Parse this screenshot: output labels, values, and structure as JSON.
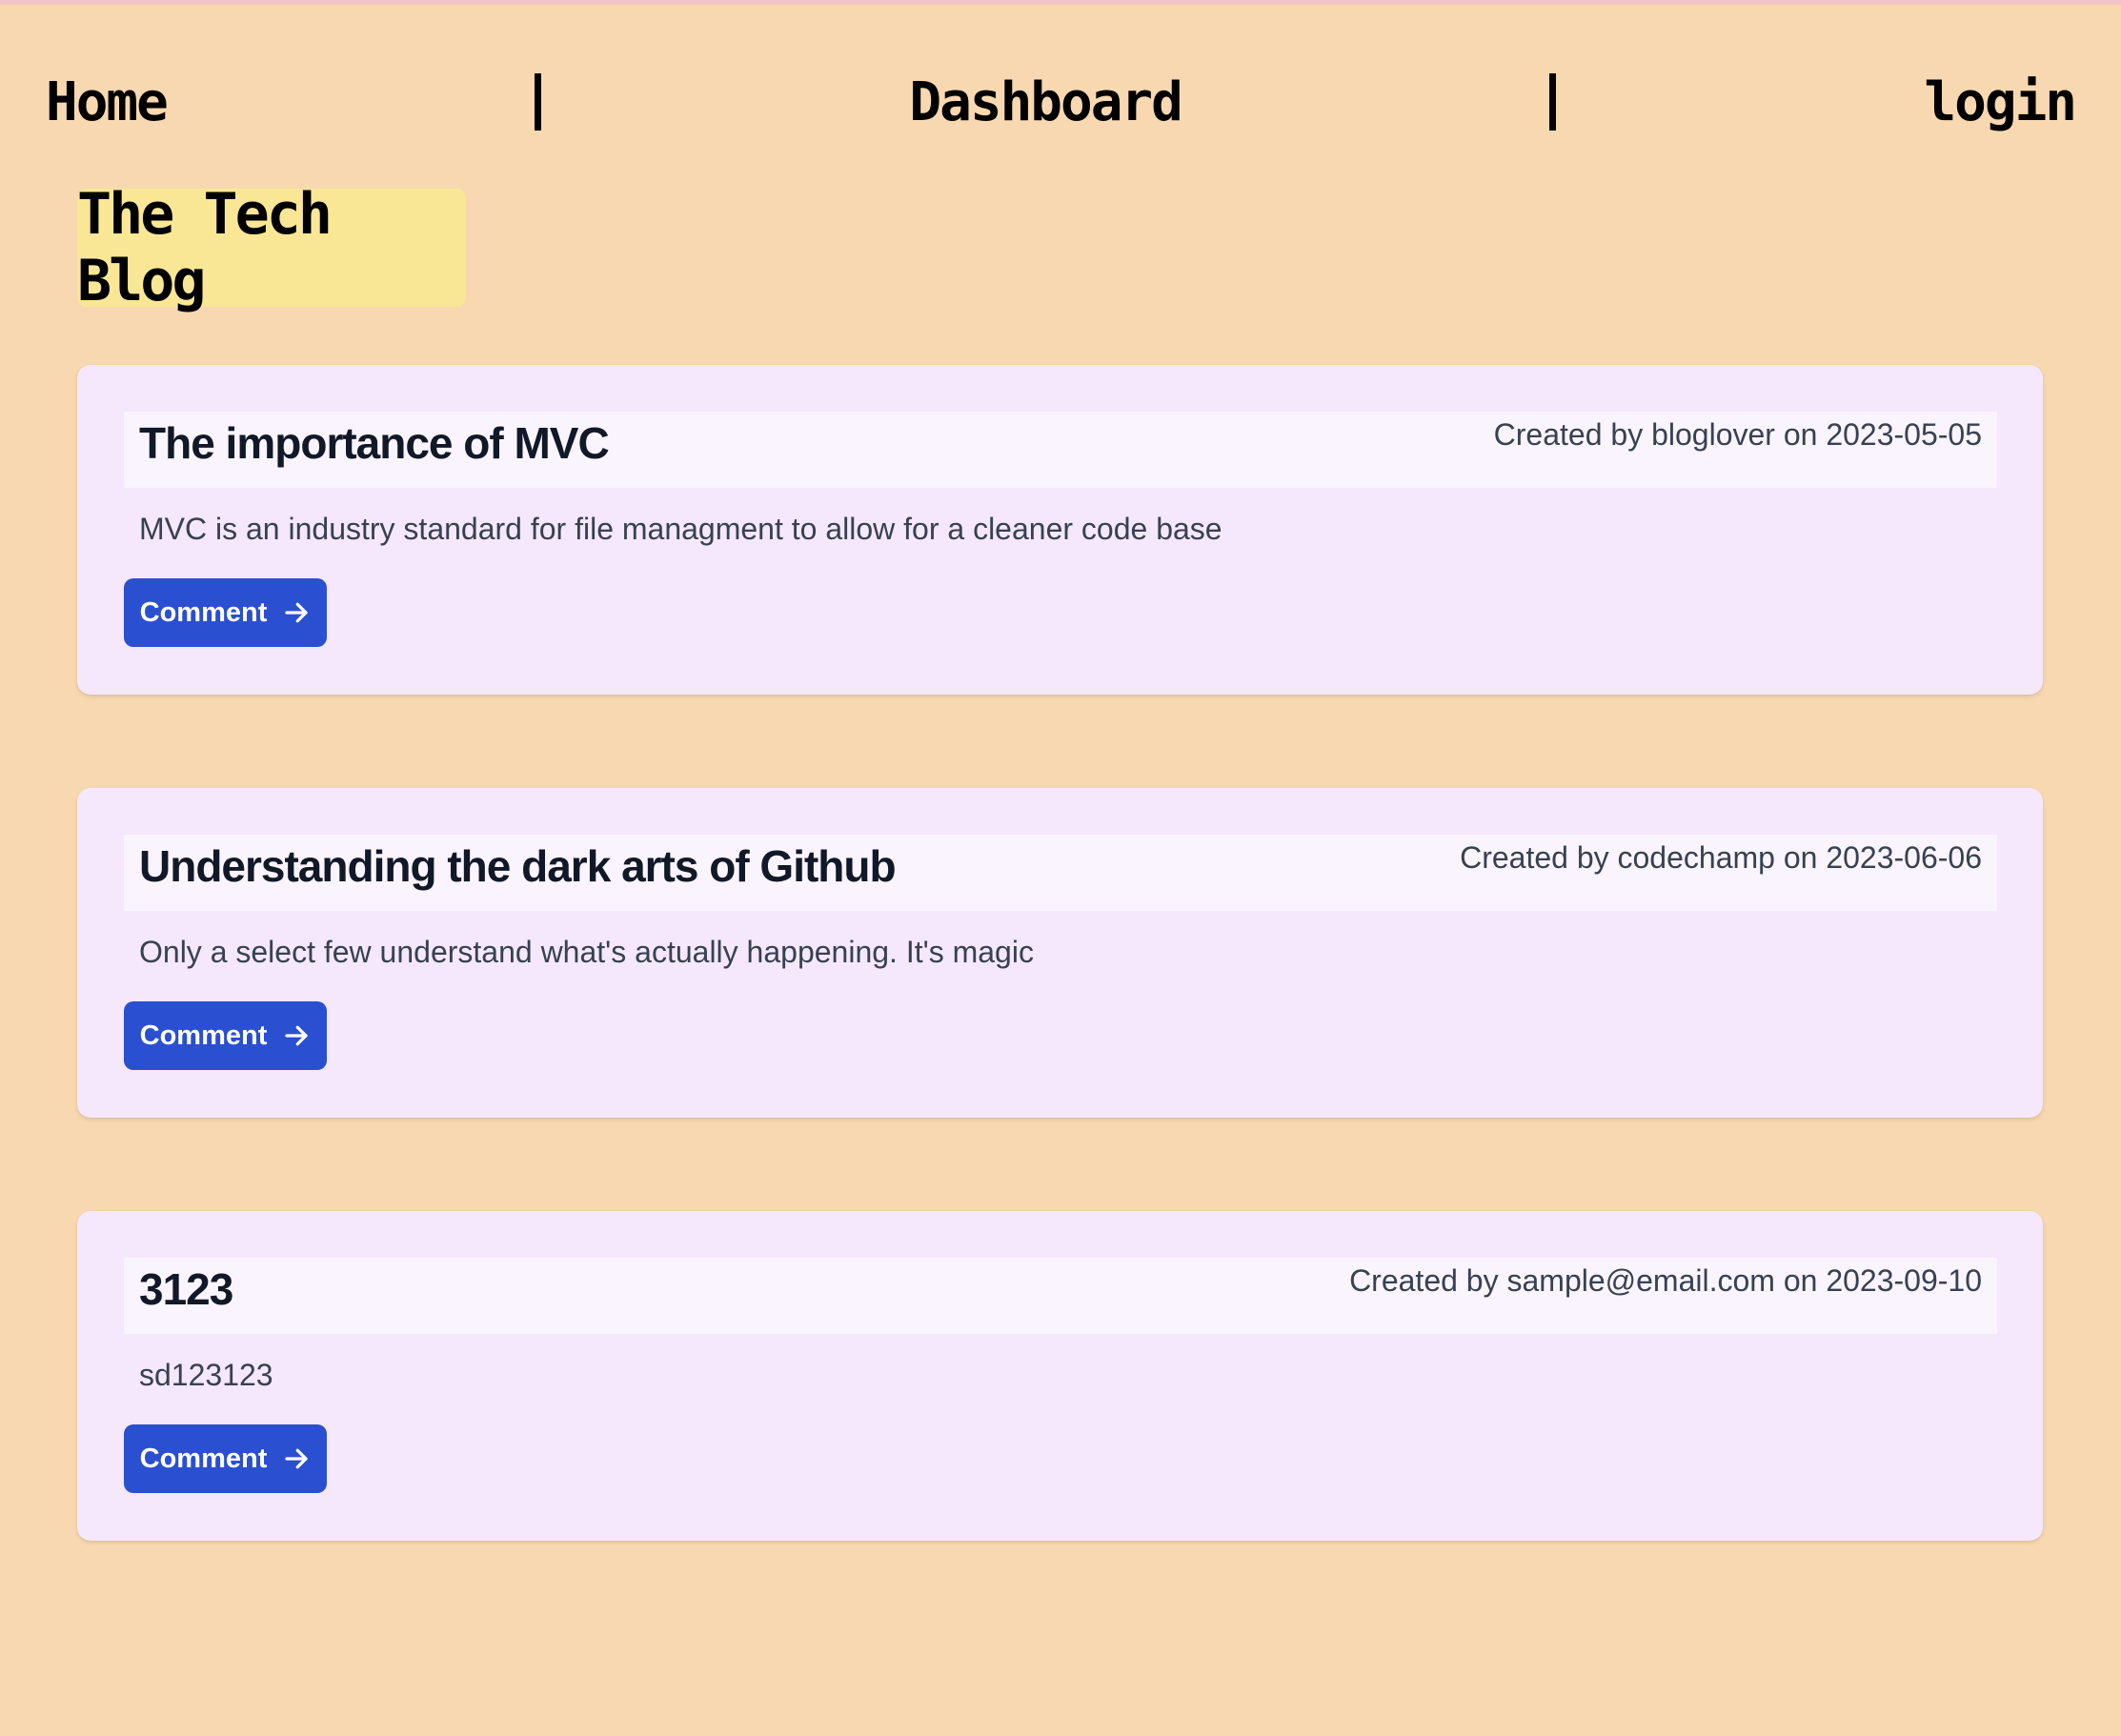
{
  "nav": {
    "home": "Home",
    "dashboard": "Dashboard",
    "login": "login"
  },
  "brand": {
    "title": "The Tech Blog"
  },
  "posts": [
    {
      "title": "The importance of MVC",
      "meta": "Created by bloglover on 2023-05-05",
      "body": "MVC is an industry standard for file managment to allow for a cleaner code base",
      "button_label": "Comment"
    },
    {
      "title": "Understanding the dark arts of Github",
      "meta": "Created by codechamp on 2023-06-06",
      "body": "Only a select few understand what's actually happening. It's magic",
      "button_label": "Comment"
    },
    {
      "title": "3123",
      "meta": "Created by sample@email.com on 2023-09-10",
      "body": "sd123123",
      "button_label": "Comment"
    }
  ],
  "colors": {
    "page_bg": "#f8d8b0",
    "brand_bg": "#f9e796",
    "card_bg": "#f5e8fc",
    "card_header_bg": "#faf4fe",
    "button_bg": "#2a4fd1"
  },
  "icons": {
    "button_icon": "arrow-right-icon"
  }
}
